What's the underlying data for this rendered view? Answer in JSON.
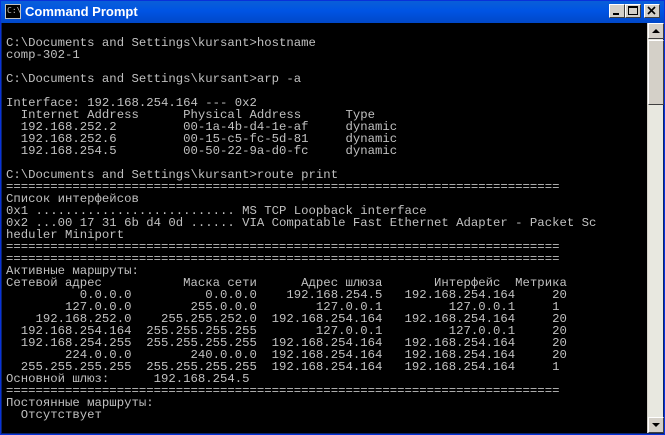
{
  "window": {
    "title": "Command Prompt",
    "icon_label": "C:\\",
    "icon_name": "console-app-icon",
    "buttons": {
      "minimize": "minimize-icon",
      "maximize": "maximize-icon",
      "close": "close-icon"
    }
  },
  "colors": {
    "titlebar": "#0054e3",
    "console_background": "#000000",
    "console_text": "#c0c0c0"
  },
  "console": {
    "lines": [
      "",
      "C:\\Documents and Settings\\kursant>hostname",
      "comp-302-1",
      "",
      "C:\\Documents and Settings\\kursant>arp -a",
      "",
      "Interface: 192.168.254.164 --- 0x2",
      "  Internet Address      Physical Address      Type",
      "  192.168.252.2         00-1a-4b-d4-1e-af     dynamic",
      "  192.168.252.6         00-15-c5-fc-5d-81     dynamic",
      "  192.168.254.5         00-50-22-9a-d0-fc     dynamic",
      "",
      "C:\\Documents and Settings\\kursant>route print",
      "===========================================================================",
      "Список интерфейсов",
      "0x1 ........................... MS TCP Loopback interface",
      "0x2 ...00 17 31 6b d4 0d ...... VIA Compatable Fast Ethernet Adapter - Packet Sc",
      "heduler Miniport",
      "===========================================================================",
      "===========================================================================",
      "Активные маршруты:",
      "Сетевой адрес           Маска сети      Адрес шлюза       Интерфейс  Метрика",
      "          0.0.0.0          0.0.0.0    192.168.254.5   192.168.254.164     20",
      "        127.0.0.0        255.0.0.0        127.0.0.1         127.0.0.1     1",
      "    192.168.252.0    255.255.252.0  192.168.254.164   192.168.254.164     20",
      "  192.168.254.164  255.255.255.255        127.0.0.1         127.0.0.1     20",
      "  192.168.254.255  255.255.255.255  192.168.254.164   192.168.254.164     20",
      "        224.0.0.0        240.0.0.0  192.168.254.164   192.168.254.164     20",
      "  255.255.255.255  255.255.255.255  192.168.254.164   192.168.254.164     1",
      "Основной шлюз:      192.168.254.5",
      "===========================================================================",
      "Постоянные маршруты:",
      "  Отсутствует"
    ]
  }
}
